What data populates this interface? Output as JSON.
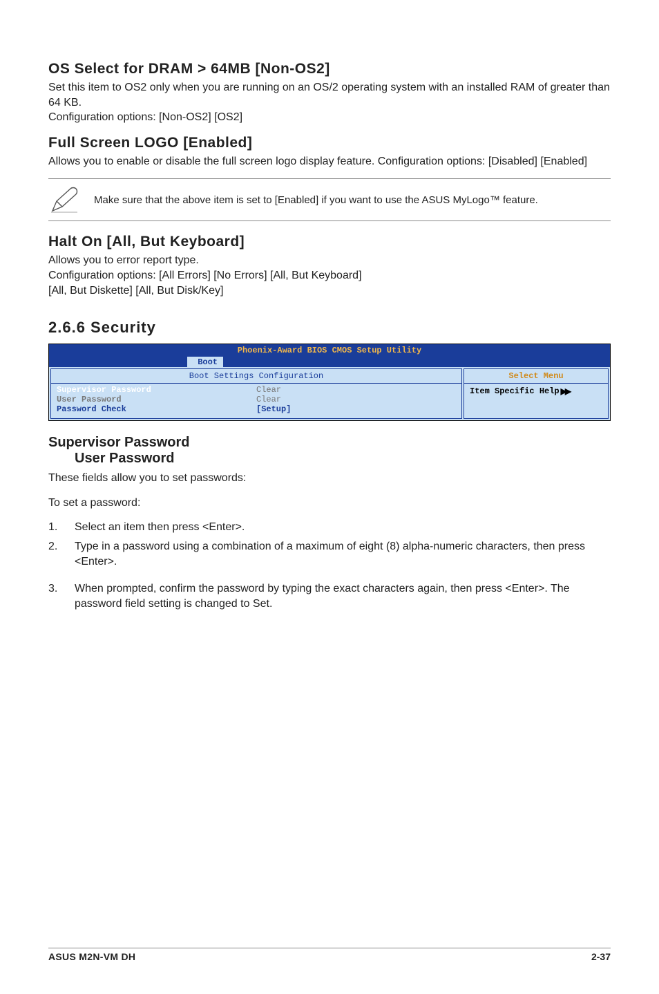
{
  "s1": {
    "title": "OS Select for DRAM > 64MB [Non-OS2]",
    "body": "Set this item to OS2 only when you are running on an OS/2 operating system with an installed RAM of greater than 64 KB.\nConfiguration options: [Non-OS2] [OS2]"
  },
  "s2": {
    "title": "Full Screen LOGO [Enabled]",
    "body": "Allows you to enable or disable the full screen logo display feature. Configuration options: [Disabled] [Enabled]"
  },
  "note": "Make sure that the above item is set to [Enabled] if you want to use the ASUS MyLogo™ feature.",
  "s3": {
    "title": "Halt On [All, But Keyboard]",
    "body": "Allows you to error report type.\nConfiguration options: [All Errors] [No Errors] [All, But Keyboard]\n[All, But Diskette] [All, But Disk/Key]"
  },
  "sec": {
    "num_title": "2.6.6  Security"
  },
  "bios": {
    "title": "Phoenix-Award BIOS CMOS Setup Utility",
    "tab": "Boot",
    "subheader": "Boot Settings Configuration",
    "rows": [
      {
        "label": "Supervisor Password",
        "value": "Clear",
        "cls": "active"
      },
      {
        "label": "User Password",
        "value": "Clear",
        "cls": ""
      },
      {
        "label": "Password Check",
        "value": "[Setup]",
        "cls": "link"
      }
    ],
    "help_title": "Select Menu",
    "help_body": "Item Specific Help"
  },
  "pw": {
    "h1": "Supervisor Password",
    "h2": "User Password",
    "intro": "These fields allow you to set passwords:",
    "toset": "To set a password:",
    "steps": [
      "Select an item then press <Enter>.",
      "Type in a password using a combination of a maximum of eight (8) alpha-numeric characters, then press <Enter>.",
      "When prompted, confirm the password by typing the exact characters again, then press <Enter>. The password field setting is changed to Set."
    ]
  },
  "footer": {
    "left": "ASUS M2N-VM DH",
    "right": "2-37"
  }
}
